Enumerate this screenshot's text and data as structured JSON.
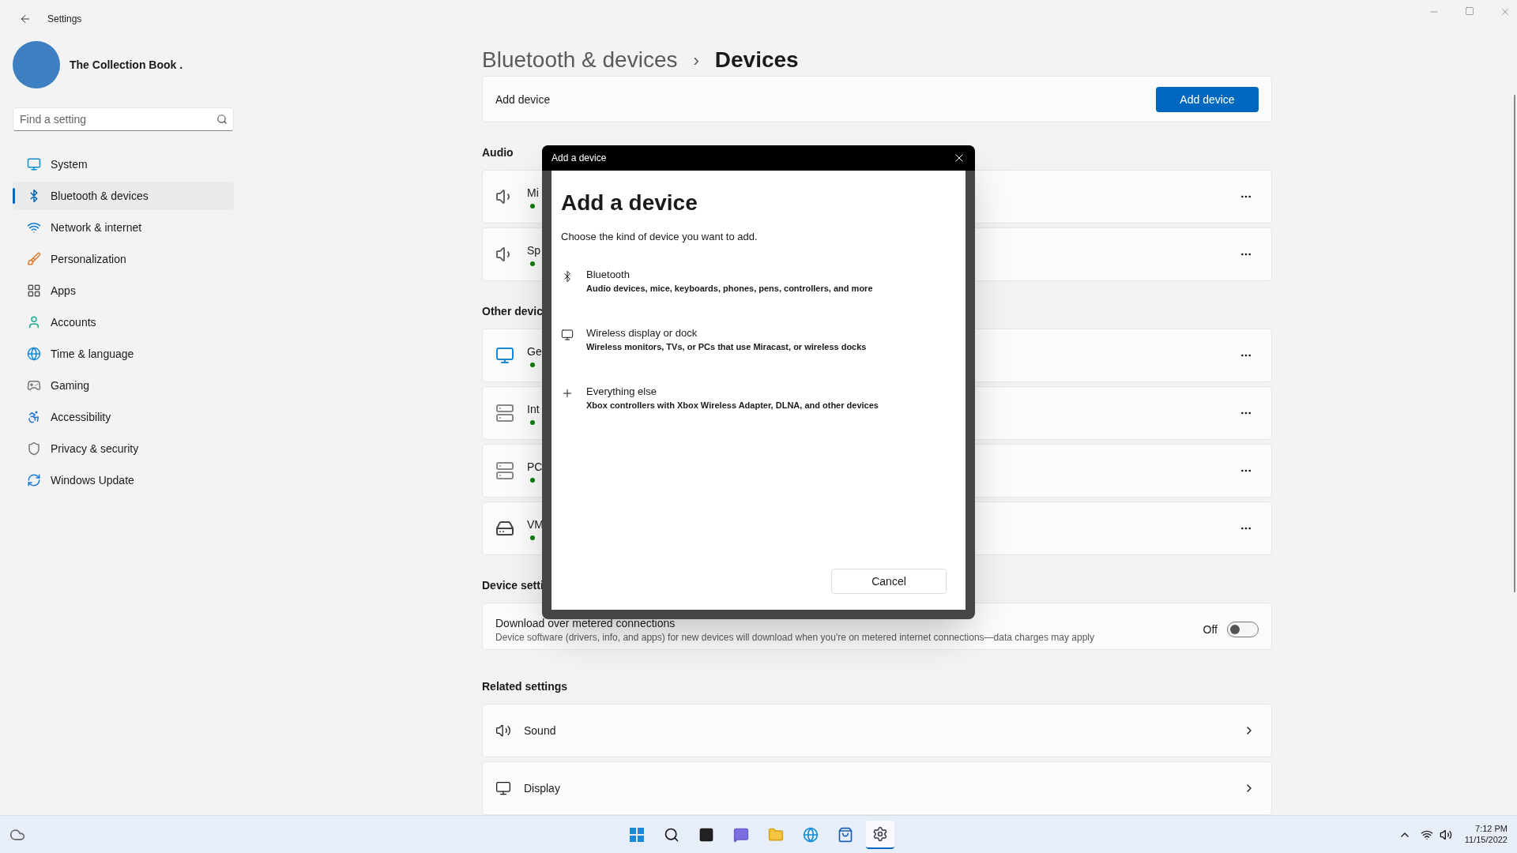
{
  "window": {
    "title": "Settings"
  },
  "account": {
    "name": "The Collection Book ."
  },
  "search": {
    "placeholder": "Find a setting"
  },
  "sidebar": {
    "items": [
      {
        "label": "System",
        "selected": false
      },
      {
        "label": "Bluetooth & devices",
        "selected": true
      },
      {
        "label": "Network & internet",
        "selected": false
      },
      {
        "label": "Personalization",
        "selected": false
      },
      {
        "label": "Apps",
        "selected": false
      },
      {
        "label": "Accounts",
        "selected": false
      },
      {
        "label": "Time & language",
        "selected": false
      },
      {
        "label": "Gaming",
        "selected": false
      },
      {
        "label": "Accessibility",
        "selected": false
      },
      {
        "label": "Privacy & security",
        "selected": false
      },
      {
        "label": "Windows Update",
        "selected": false
      }
    ]
  },
  "breadcrumb": {
    "parent": "Bluetooth & devices",
    "separator": "›",
    "current": "Devices"
  },
  "add_device_card": {
    "label": "Add device",
    "button": "Add device"
  },
  "sections": [
    {
      "title": "Audio",
      "devices": [
        {
          "name": "Mi",
          "connected": true
        },
        {
          "name": "Sp",
          "connected": true
        }
      ]
    },
    {
      "title": "Other devic",
      "devices": [
        {
          "name": "Ge",
          "connected": true
        },
        {
          "name": "Int",
          "connected": true
        },
        {
          "name": "PC",
          "connected": true
        },
        {
          "name": "VM",
          "connected": true
        }
      ]
    }
  ],
  "device_settings": {
    "title": "Device setti",
    "setting": {
      "label": "Download over metered connections",
      "description": "Device software (drivers, info, and apps) for new devices will download when you're on metered internet connections—data charges may apply",
      "state_label": "Off",
      "on": false
    }
  },
  "related_settings": {
    "title": "Related settings",
    "items": [
      "Sound",
      "Display"
    ]
  },
  "dialog": {
    "title": "Add a device",
    "heading": "Add a device",
    "subtitle": "Choose the kind of device you want to add.",
    "options": [
      {
        "kind": "bluetooth",
        "title": "Bluetooth",
        "description": "Audio devices, mice, keyboards, phones, pens, controllers, and more"
      },
      {
        "kind": "display",
        "title": "Wireless display or dock",
        "description": "Wireless monitors, TVs, or PCs that use Miracast, or wireless docks"
      },
      {
        "kind": "other",
        "title": "Everything else",
        "description": "Xbox controllers with Xbox Wireless Adapter, DLNA, and other devices"
      }
    ],
    "button": "Cancel"
  },
  "taskbar": {
    "time": "7:12 PM",
    "date": "11/15/2022"
  }
}
